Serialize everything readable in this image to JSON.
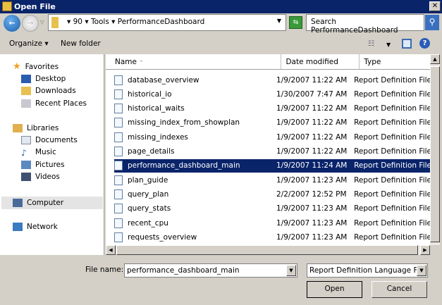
{
  "window": {
    "title": "Open File",
    "close": "✕"
  },
  "nav": {
    "back": "←",
    "forward": "→",
    "path": [
      "90",
      "Tools",
      "PerformanceDashboard"
    ],
    "search_placeholder": "Search PerformanceDashboard"
  },
  "toolbar": {
    "organize": "Organize ▾",
    "new_folder": "New folder"
  },
  "sidebar": {
    "favorites": "Favorites",
    "fav_items": [
      "Desktop",
      "Downloads",
      "Recent Places"
    ],
    "libraries": "Libraries",
    "lib_items": [
      "Documents",
      "Music",
      "Pictures",
      "Videos"
    ],
    "computer": "Computer",
    "network": "Network"
  },
  "columns": {
    "name": "Name",
    "date": "Date modified",
    "type": "Type"
  },
  "files": [
    {
      "name": "database_overview",
      "date": "1/9/2007 11:22 AM",
      "type": "Report Definition File"
    },
    {
      "name": "historical_io",
      "date": "1/30/2007 7:47 AM",
      "type": "Report Definition File"
    },
    {
      "name": "historical_waits",
      "date": "1/9/2007 11:22 AM",
      "type": "Report Definition File"
    },
    {
      "name": "missing_index_from_showplan",
      "date": "1/9/2007 11:22 AM",
      "type": "Report Definition File"
    },
    {
      "name": "missing_indexes",
      "date": "1/9/2007 11:22 AM",
      "type": "Report Definition File"
    },
    {
      "name": "page_details",
      "date": "1/9/2007 11:22 AM",
      "type": "Report Definition File"
    },
    {
      "name": "performance_dashboard_main",
      "date": "1/9/2007 11:24 AM",
      "type": "Report Definition File"
    },
    {
      "name": "plan_guide",
      "date": "1/9/2007 11:23 AM",
      "type": "Report Definition File"
    },
    {
      "name": "query_plan",
      "date": "2/2/2007 12:52 PM",
      "type": "Report Definition File"
    },
    {
      "name": "query_stats",
      "date": "1/9/2007 11:23 AM",
      "type": "Report Definition File"
    },
    {
      "name": "recent_cpu",
      "date": "1/9/2007 11:23 AM",
      "type": "Report Definition File"
    },
    {
      "name": "requests_overview",
      "date": "1/9/2007 11:23 AM",
      "type": "Report Definition File"
    }
  ],
  "selected_index": 6,
  "bottom": {
    "file_name_label": "File name:",
    "file_name_value": "performance_dashboard_main",
    "file_type": "Report Definition Language File",
    "open": "Open",
    "cancel": "Cancel"
  }
}
